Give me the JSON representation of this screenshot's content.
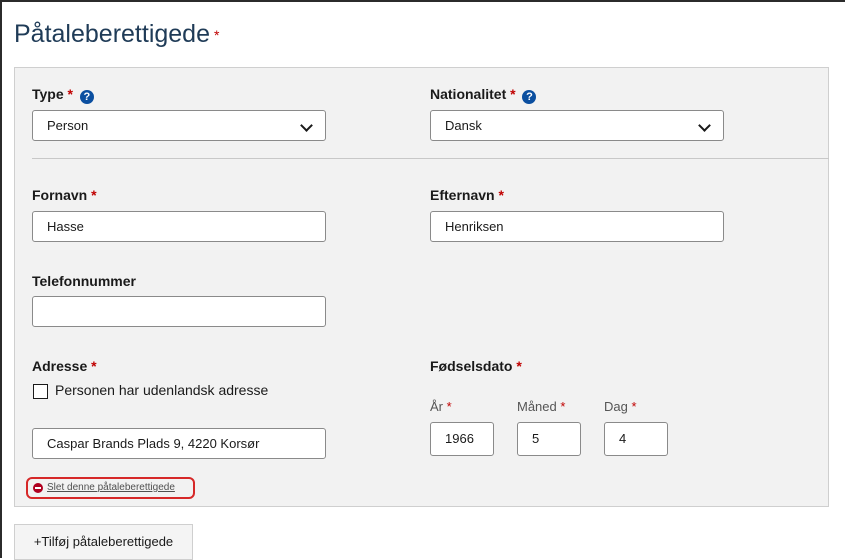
{
  "section": {
    "title": "Påtaleberettigede",
    "required_mark": "*"
  },
  "type_field": {
    "label": "Type",
    "required_mark": "*",
    "help_icon": "question-circle-icon",
    "value": "Person"
  },
  "nationality_field": {
    "label": "Nationalitet",
    "required_mark": "*",
    "help_icon": "question-circle-icon",
    "value": "Dansk"
  },
  "firstname_field": {
    "label": "Fornavn",
    "required_mark": "*",
    "value": "Hasse"
  },
  "lastname_field": {
    "label": "Efternavn",
    "required_mark": "*",
    "value": "Henriksen"
  },
  "phone_field": {
    "label": "Telefonnummer",
    "value": ""
  },
  "address_field": {
    "label": "Adresse",
    "required_mark": "*",
    "foreign_checkbox_label": "Personen har udenlandsk adresse",
    "foreign_checked": false,
    "value": "Caspar Brands Plads 9, 4220 Korsør"
  },
  "birthdate_field": {
    "label": "Fødselsdato",
    "required_mark": "*",
    "year_label": "År",
    "month_label": "Måned",
    "day_label": "Dag",
    "year": "1966",
    "month": "5",
    "day": "4"
  },
  "actions": {
    "delete_label": "Slet denne påtaleberettigede",
    "delete_icon": "minus-circle-icon",
    "add_label": "+Tilføj påtaleberettigede"
  },
  "colors": {
    "title": "#1f3b57",
    "required": "#c00000",
    "help_icon": "#0b4fa0",
    "highlight_border": "#d62828",
    "panel_bg": "#f2f2f2"
  }
}
